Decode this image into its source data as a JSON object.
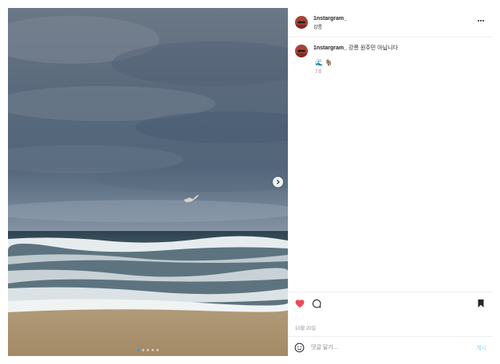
{
  "post": {
    "username": "1nstargram_",
    "location": "강릉",
    "more_icon": "more-horizontal-icon",
    "media": {
      "image_count": 5,
      "active_index": 1,
      "next_icon": "chevron-right-icon"
    },
    "caption": {
      "text": "강릉 원주민 아닙니다",
      "emojis": [
        "🌊",
        "🐐"
      ],
      "time_ago": "7주"
    },
    "actions": {
      "like_icon": "heart-filled-icon",
      "like_color": "#ed4956",
      "comment_icon": "comment-icon",
      "save_icon": "bookmark-filled-icon"
    },
    "date": "10월 20일",
    "comment_box": {
      "emoji_icon": "smiley-icon",
      "placeholder": "댓글 달기...",
      "post_label": "게시"
    }
  }
}
